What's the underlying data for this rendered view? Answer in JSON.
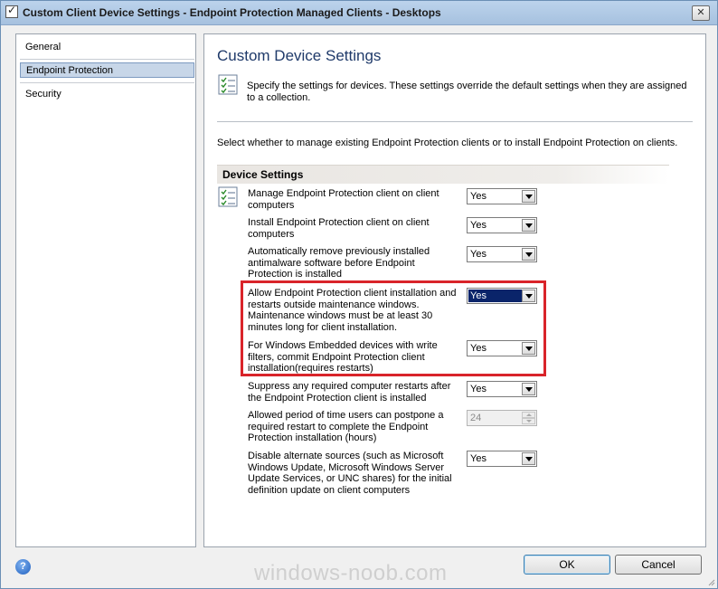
{
  "window": {
    "title": "Custom Client Device Settings - Endpoint Protection Managed Clients - Desktops",
    "close_glyph": "✕"
  },
  "sidebar": {
    "items": [
      {
        "label": "General",
        "selected": false
      },
      {
        "label": "Endpoint Protection",
        "selected": true
      },
      {
        "label": "Security",
        "selected": false
      }
    ]
  },
  "main": {
    "heading": "Custom Device Settings",
    "description": "Specify the settings for devices. These settings override the default settings when they are assigned to a collection.",
    "intro": "Select whether to manage existing Endpoint Protection clients or to install Endpoint Protection on clients.",
    "section_title": "Device Settings",
    "settings": [
      {
        "label": "Manage Endpoint Protection client on client computers",
        "value": "Yes"
      },
      {
        "label": "Install Endpoint Protection client on client computers",
        "value": "Yes"
      },
      {
        "label": "Automatically remove previously installed antimalware software before Endpoint Protection is installed",
        "value": "Yes"
      },
      {
        "label": "Allow Endpoint Protection client installation and restarts outside maintenance windows. Maintenance windows must be at least 30 minutes long for client installation.",
        "value": "Yes"
      },
      {
        "label": "For Windows Embedded devices with write filters, commit Endpoint Protection client installation(requires restarts)",
        "value": "Yes"
      },
      {
        "label": "Suppress any required computer restarts after the Endpoint Protection client is installed",
        "value": "Yes"
      },
      {
        "label": "Allowed period of time users can postpone a required restart to complete the Endpoint Protection installation (hours)",
        "value": "24",
        "disabled": true
      },
      {
        "label": "Disable alternate sources (such as Microsoft Windows Update, Microsoft Windows Server Update Services, or UNC shares) for the initial definition update on client computers",
        "value": "Yes"
      }
    ]
  },
  "footer": {
    "help_glyph": "?",
    "ok_label": "OK",
    "cancel_label": "Cancel",
    "watermark": "windows-noob.com"
  },
  "colors": {
    "highlight": "#d9242a",
    "heading": "#1f3a6a",
    "selection": "#0a246a"
  }
}
